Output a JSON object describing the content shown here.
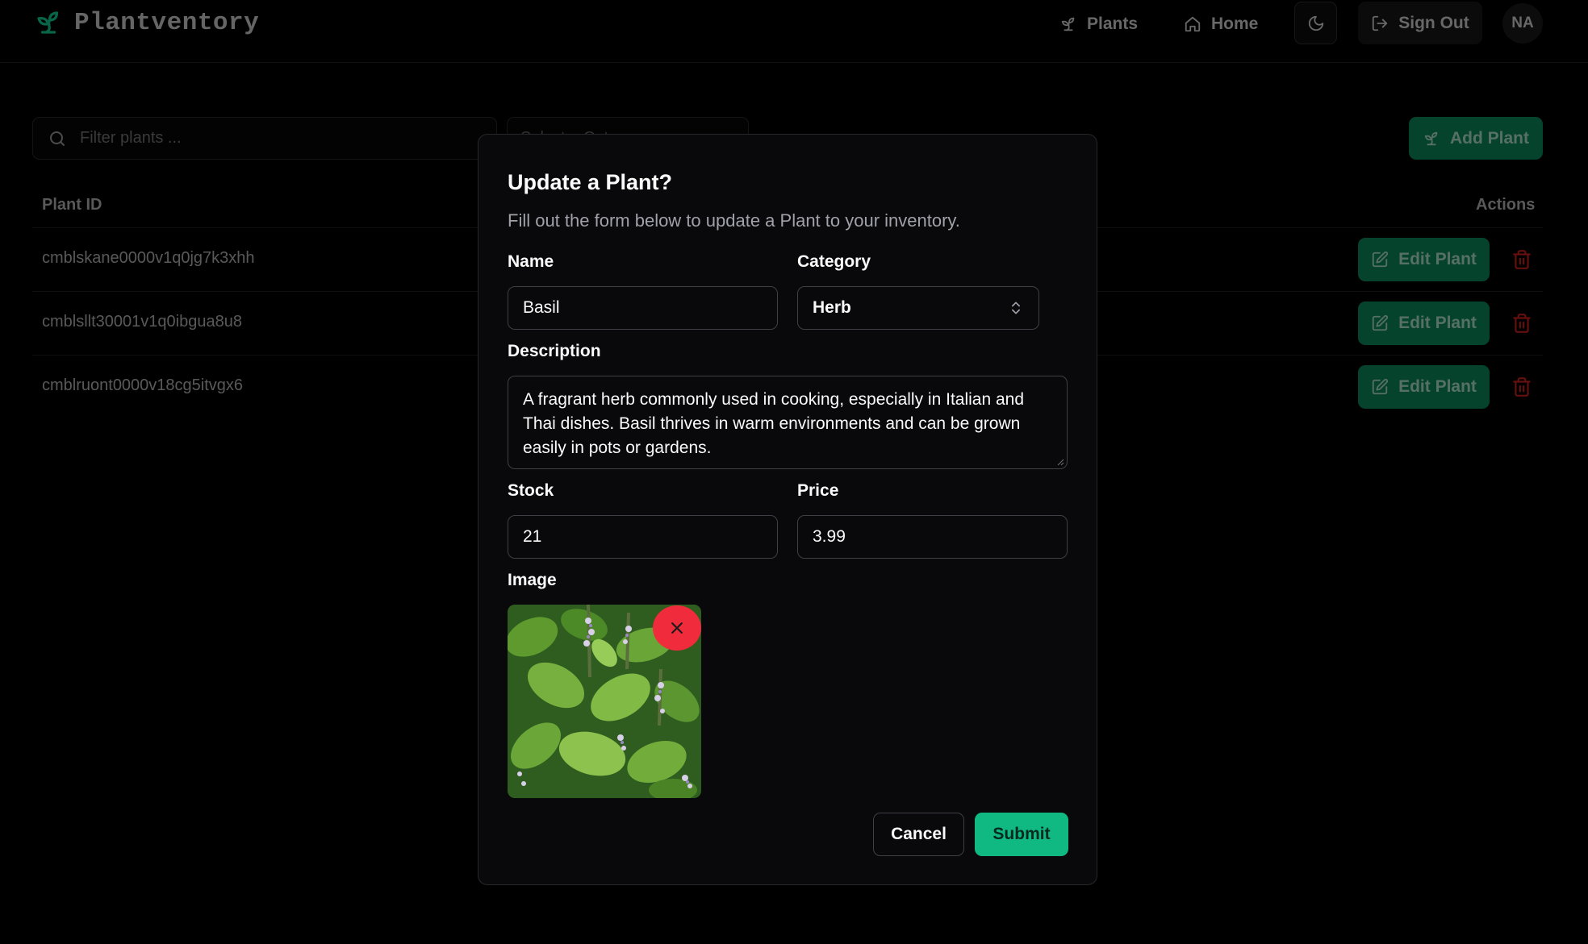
{
  "app": {
    "brand_name": "Plantventory",
    "brand_icon": "sprout-icon",
    "accent_color": "#10b981"
  },
  "nav": {
    "plants_label": "Plants",
    "home_label": "Home",
    "theme_icon": "moon-icon",
    "sign_out_label": "Sign Out",
    "avatar_initials": "NA"
  },
  "toolbar": {
    "filter_placeholder": "Filter plants ...",
    "category_placeholder": "Select a Category",
    "add_plant_label": "Add Plant"
  },
  "table": {
    "columns": [
      "Plant ID",
      "Actions"
    ],
    "rows": [
      {
        "id": "cmblskane0000v1q0jg7k3xhh",
        "edit_label": "Edit Plant"
      },
      {
        "id": "cmblsllt30001v1q0ibgua8u8",
        "edit_label": "Edit Plant"
      },
      {
        "id": "cmblruont0000v18cg5itvgx6",
        "edit_label": "Edit Plant"
      }
    ]
  },
  "modal": {
    "title": "Update a Plant?",
    "description": "Fill out the form below to update a Plant to your inventory.",
    "name_label": "Name",
    "name_value": "Basil",
    "category_label": "Category",
    "category_value": "Herb",
    "description_label": "Description",
    "description_value": "A fragrant herb commonly used in cooking, especially in Italian and Thai dishes. Basil thrives in warm environments and can be grown easily in pots or gardens.",
    "stock_label": "Stock",
    "stock_value": "21",
    "price_label": "Price",
    "price_value": "3.99",
    "image_label": "Image",
    "cancel_label": "Cancel",
    "submit_label": "Submit",
    "remove_color": "#ef2b3c"
  }
}
